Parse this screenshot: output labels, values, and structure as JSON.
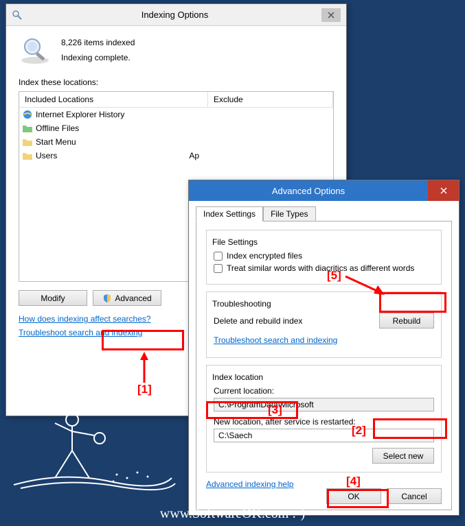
{
  "win1": {
    "title": "Indexing Options",
    "items_indexed": "8,226 items indexed",
    "status": "Indexing complete.",
    "section_label": "Index these locations:",
    "col_included": "Included Locations",
    "col_exclude": "Exclude",
    "locations": [
      {
        "label": "Internet Explorer History",
        "icon": "ie"
      },
      {
        "label": "Offline Files",
        "icon": "folder-green"
      },
      {
        "label": "Start Menu",
        "icon": "folder"
      },
      {
        "label": "Users",
        "icon": "folder"
      }
    ],
    "exclude_partial": "Ap",
    "btn_modify": "Modify",
    "btn_advanced": "Advanced",
    "link_how": "How does indexing affect searches?",
    "link_troubleshoot": "Troubleshoot search and indexing"
  },
  "win2": {
    "title": "Advanced Options",
    "tab1": "Index Settings",
    "tab2": "File Types",
    "fs_file_settings": "File Settings",
    "chk_encrypted": "Index encrypted files",
    "chk_diacritics": "Treat similar words with diacritics as different words",
    "fs_trouble": "Troubleshooting",
    "lbl_rebuild": "Delete and rebuild index",
    "btn_rebuild": "Rebuild",
    "link_trouble": "Troubleshoot search and indexing",
    "fs_location": "Index location",
    "lbl_current": "Current location:",
    "val_current": "C:\\ProgramData\\Microsoft",
    "lbl_new": "New location, after service is restarted:",
    "val_new": "C:\\Saech",
    "btn_select_new": "Select new",
    "link_adv_help": "Advanced indexing help",
    "btn_ok": "OK",
    "btn_cancel": "Cancel"
  },
  "annotations": {
    "n1": "[1]",
    "n2": "[2]",
    "n3": "[3]",
    "n4": "[4]",
    "n5": "[5]"
  },
  "watermark": "www.SoftwareOK.com :-)"
}
